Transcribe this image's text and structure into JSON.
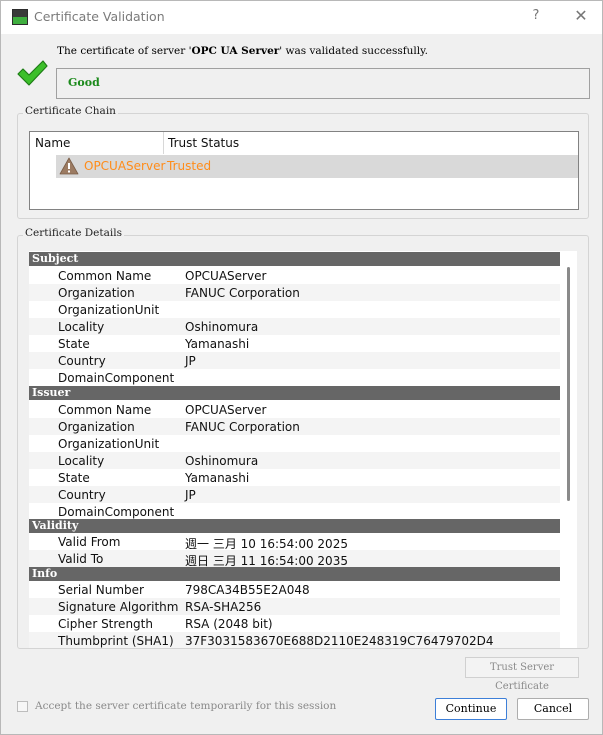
{
  "window": {
    "title": "Certificate Validation",
    "help_glyph": "?",
    "close_glyph": "✕"
  },
  "message": {
    "prefix": "The certificate of server '",
    "server": "OPC UA Server",
    "suffix": "' was validated successfully."
  },
  "status": {
    "text": "Good",
    "color": "#1c8a1c"
  },
  "chain": {
    "label": "Certificate Chain",
    "columns": [
      "Name",
      "Trust Status"
    ],
    "rows": [
      {
        "name": "OPCUAServer",
        "trust": "Trusted"
      }
    ]
  },
  "details": {
    "label": "Certificate Details",
    "sections": [
      {
        "title": "Subject",
        "rows": [
          {
            "k": "Common Name",
            "v": "OPCUAServer"
          },
          {
            "k": "Organization",
            "v": "FANUC Corporation"
          },
          {
            "k": "OrganizationUnit",
            "v": ""
          },
          {
            "k": "Locality",
            "v": "Oshinomura"
          },
          {
            "k": "State",
            "v": "Yamanashi"
          },
          {
            "k": "Country",
            "v": "JP"
          },
          {
            "k": "DomainComponent",
            "v": ""
          }
        ]
      },
      {
        "title": "Issuer",
        "rows": [
          {
            "k": "Common Name",
            "v": "OPCUAServer"
          },
          {
            "k": "Organization",
            "v": "FANUC Corporation"
          },
          {
            "k": "OrganizationUnit",
            "v": ""
          },
          {
            "k": "Locality",
            "v": "Oshinomura"
          },
          {
            "k": "State",
            "v": "Yamanashi"
          },
          {
            "k": "Country",
            "v": "JP"
          },
          {
            "k": "DomainComponent",
            "v": ""
          }
        ]
      },
      {
        "title": "Validity",
        "rows": [
          {
            "k": "Valid From",
            "v": "週一 三月 10 16:54:00 2025"
          },
          {
            "k": "Valid To",
            "v": "週日 三月 11 16:54:00 2035"
          }
        ]
      },
      {
        "title": "Info",
        "rows": [
          {
            "k": "Serial Number",
            "v": "798CA34B55E2A048"
          },
          {
            "k": "Signature Algorithm",
            "v": "RSA-SHA256"
          },
          {
            "k": "Cipher Strength",
            "v": "RSA (2048 bit)"
          },
          {
            "k": "Thumbprint (SHA1)",
            "v": "37F3031583670E688D2110E248319C76479702D4"
          }
        ]
      }
    ]
  },
  "trust_button": "Trust Server Certificate",
  "accept_label": "Accept the server certificate temporarily for this session",
  "accept_checked": false,
  "buttons": {
    "continue": "Continue",
    "cancel": "Cancel"
  }
}
